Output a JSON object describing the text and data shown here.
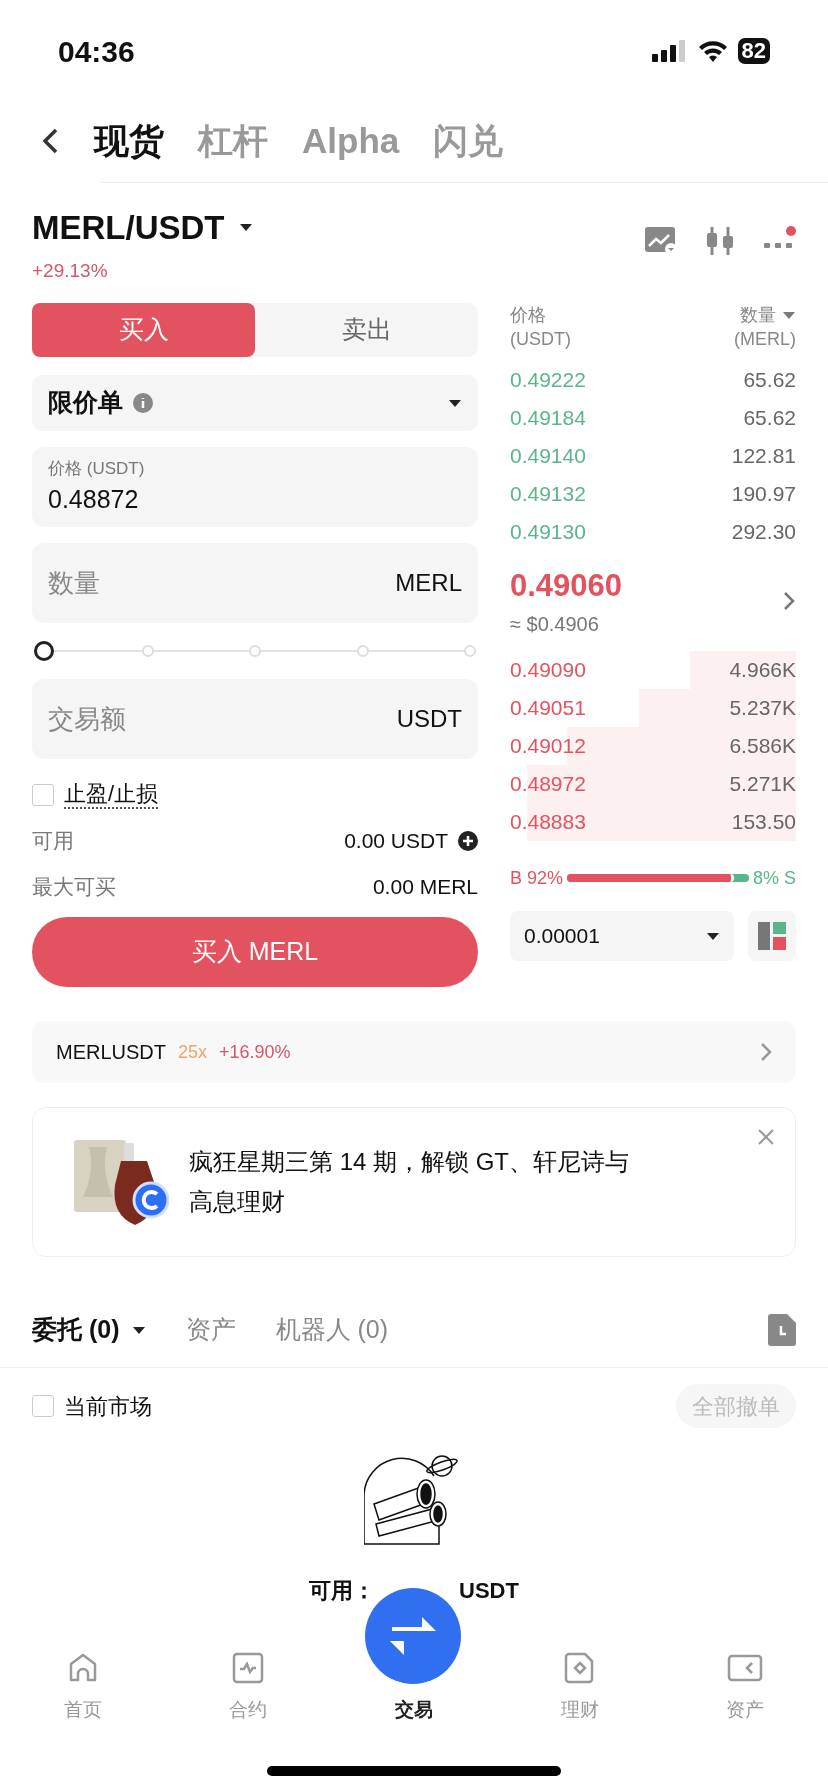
{
  "status_bar": {
    "time": "04:36",
    "battery": "82"
  },
  "top_tabs": [
    {
      "label": "现货",
      "selected": true
    },
    {
      "label": "杠杆",
      "selected": false
    },
    {
      "label": "Alpha",
      "selected": false
    },
    {
      "label": "闪兑",
      "selected": false
    }
  ],
  "pair": {
    "name": "MERL/USDT",
    "change": "+29.13%"
  },
  "side_tabs": [
    {
      "label": "买入",
      "selected": true
    },
    {
      "label": "卖出",
      "selected": false
    }
  ],
  "order_type": "限价单",
  "price_field": {
    "label": "价格 (USDT)",
    "value": "0.48872"
  },
  "amount_field": {
    "placeholder": "数量",
    "unit": "MERL"
  },
  "slider": {
    "level": 0
  },
  "total_field": {
    "placeholder": "交易额",
    "unit": "USDT"
  },
  "tpsl": {
    "label": "止盈/止损",
    "checked": false
  },
  "available": {
    "label": "可用",
    "value": "0.00 USDT"
  },
  "max_buy": {
    "label": "最大可买",
    "value": "0.00 MERL"
  },
  "buy_button": "买入 MERL",
  "order_book": {
    "price_header": "价格",
    "price_unit": "(USDT)",
    "qty_header": "数量",
    "qty_unit": "(MERL)",
    "asks": [
      {
        "price": "0.49222",
        "qty": "65.62"
      },
      {
        "price": "0.49184",
        "qty": "65.62"
      },
      {
        "price": "0.49140",
        "qty": "122.81"
      },
      {
        "price": "0.49132",
        "qty": "190.97"
      },
      {
        "price": "0.49130",
        "qty": "292.30"
      }
    ],
    "last_price": "0.49060",
    "last_usd": "≈ $0.4906",
    "bids": [
      {
        "price": "0.49090",
        "qty": "4.966K"
      },
      {
        "price": "0.49051",
        "qty": "5.237K"
      },
      {
        "price": "0.49012",
        "qty": "6.586K"
      },
      {
        "price": "0.48972",
        "qty": "5.271K"
      },
      {
        "price": "0.48883",
        "qty": "153.50"
      }
    ],
    "buy_ratio": {
      "buy_label": "B 92%",
      "sell_label": "8% S",
      "level": 0.92
    },
    "precision": "0.00001"
  },
  "futures_row": {
    "symbol": "MERLUSDT",
    "leverage": "25x",
    "change": "+16.90%"
  },
  "banner": {
    "text": "疯狂星期三第 14 期，解锁 GT、轩尼诗与高息理财"
  },
  "order_tabs": [
    {
      "label": "委托 (0)",
      "selected": true
    },
    {
      "label": "资产",
      "selected": false
    },
    {
      "label": "机器人 (0)",
      "selected": false
    }
  ],
  "current_market": {
    "label": "当前市场",
    "checked": false
  },
  "cancel_all": "全部撤单",
  "empty_state": {
    "label": "可用：",
    "unit": "USDT"
  },
  "bottom_nav": [
    {
      "label": "首页",
      "kind": "tab",
      "selected": false
    },
    {
      "label": "合约",
      "kind": "tab",
      "selected": false
    },
    {
      "label": "交易",
      "kind": "center",
      "selected": true
    },
    {
      "label": "理财",
      "kind": "tab",
      "selected": false
    },
    {
      "label": "资产",
      "kind": "tab",
      "selected": false
    }
  ]
}
